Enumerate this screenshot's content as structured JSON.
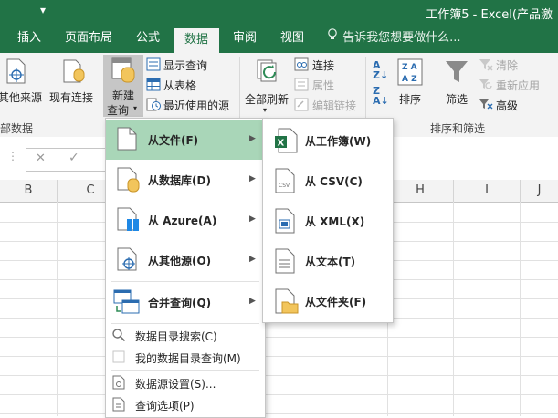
{
  "window": {
    "title": "工作簿5 - Excel(产品激"
  },
  "tabs": [
    {
      "label": "插入"
    },
    {
      "label": "页面布局"
    },
    {
      "label": "公式"
    },
    {
      "label": "数据"
    },
    {
      "label": "审阅"
    },
    {
      "label": "视图"
    }
  ],
  "tell_me": {
    "text": "告诉我您想要做什么..."
  },
  "ribbon": {
    "other_sources": "其他来源",
    "existing_connections": "现有连接",
    "get_data_group": "部数据",
    "new_query_line1": "新建",
    "new_query_line2": "查询",
    "show_queries": "显示查询",
    "from_table": "从表格",
    "recent_sources": "最近使用的源",
    "refresh_all": "全部刷新",
    "connections": "连接",
    "properties": "属性",
    "edit_links": "编辑链接",
    "sort": "排序",
    "filter": "筛选",
    "clear": "清除",
    "reapply": "重新应用",
    "advanced": "高级",
    "sort_filter_group": "排序和筛选"
  },
  "columns": [
    "B",
    "C",
    "H",
    "I",
    "J"
  ],
  "menu": {
    "items": [
      {
        "label": "从文件(F)"
      },
      {
        "label": "从数据库(D)"
      },
      {
        "label": "从 Azure(A)"
      },
      {
        "label": "从其他源(O)"
      },
      {
        "label": "合并查询(Q)"
      }
    ],
    "small_items": [
      {
        "label": "数据目录搜索(C)"
      },
      {
        "label": "我的数据目录查询(M)"
      },
      {
        "label": "数据源设置(S)..."
      },
      {
        "label": "查询选项(P)"
      }
    ]
  },
  "submenu": {
    "items": [
      {
        "label": "从工作簿(W)"
      },
      {
        "label": "从 CSV(C)"
      },
      {
        "label": "从 XML(X)"
      },
      {
        "label": "从文本(T)"
      },
      {
        "label": "从文件夹(F)"
      }
    ],
    "csv_icon_text": "CSV"
  },
  "colors": {
    "accent": "#217346",
    "hover": "#a9d6b8"
  }
}
